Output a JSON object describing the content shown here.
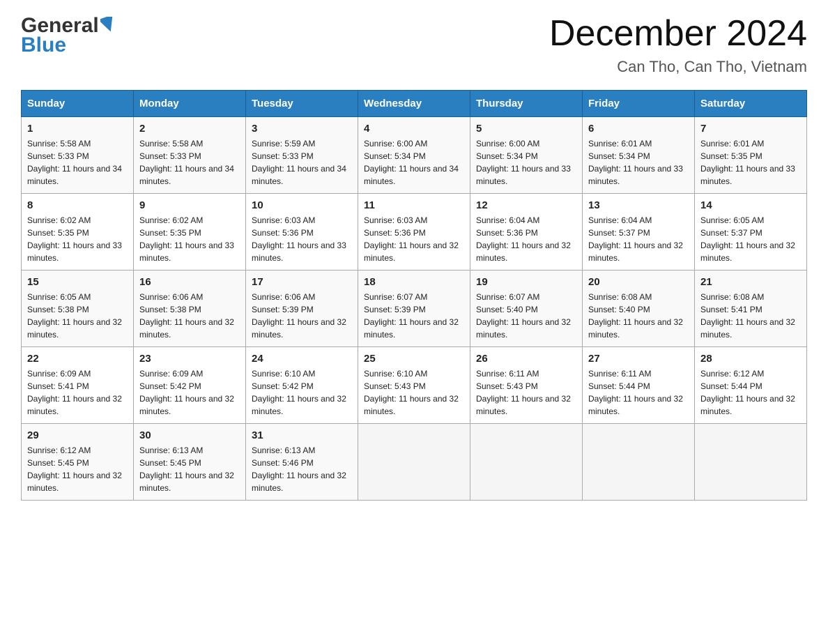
{
  "header": {
    "logo_general": "General",
    "logo_blue": "Blue",
    "month_title": "December 2024",
    "location": "Can Tho, Can Tho, Vietnam"
  },
  "days_of_week": [
    "Sunday",
    "Monday",
    "Tuesday",
    "Wednesday",
    "Thursday",
    "Friday",
    "Saturday"
  ],
  "weeks": [
    [
      {
        "day": "1",
        "sunrise": "5:58 AM",
        "sunset": "5:33 PM",
        "daylight": "11 hours and 34 minutes."
      },
      {
        "day": "2",
        "sunrise": "5:58 AM",
        "sunset": "5:33 PM",
        "daylight": "11 hours and 34 minutes."
      },
      {
        "day": "3",
        "sunrise": "5:59 AM",
        "sunset": "5:33 PM",
        "daylight": "11 hours and 34 minutes."
      },
      {
        "day": "4",
        "sunrise": "6:00 AM",
        "sunset": "5:34 PM",
        "daylight": "11 hours and 34 minutes."
      },
      {
        "day": "5",
        "sunrise": "6:00 AM",
        "sunset": "5:34 PM",
        "daylight": "11 hours and 33 minutes."
      },
      {
        "day": "6",
        "sunrise": "6:01 AM",
        "sunset": "5:34 PM",
        "daylight": "11 hours and 33 minutes."
      },
      {
        "day": "7",
        "sunrise": "6:01 AM",
        "sunset": "5:35 PM",
        "daylight": "11 hours and 33 minutes."
      }
    ],
    [
      {
        "day": "8",
        "sunrise": "6:02 AM",
        "sunset": "5:35 PM",
        "daylight": "11 hours and 33 minutes."
      },
      {
        "day": "9",
        "sunrise": "6:02 AM",
        "sunset": "5:35 PM",
        "daylight": "11 hours and 33 minutes."
      },
      {
        "day": "10",
        "sunrise": "6:03 AM",
        "sunset": "5:36 PM",
        "daylight": "11 hours and 33 minutes."
      },
      {
        "day": "11",
        "sunrise": "6:03 AM",
        "sunset": "5:36 PM",
        "daylight": "11 hours and 32 minutes."
      },
      {
        "day": "12",
        "sunrise": "6:04 AM",
        "sunset": "5:36 PM",
        "daylight": "11 hours and 32 minutes."
      },
      {
        "day": "13",
        "sunrise": "6:04 AM",
        "sunset": "5:37 PM",
        "daylight": "11 hours and 32 minutes."
      },
      {
        "day": "14",
        "sunrise": "6:05 AM",
        "sunset": "5:37 PM",
        "daylight": "11 hours and 32 minutes."
      }
    ],
    [
      {
        "day": "15",
        "sunrise": "6:05 AM",
        "sunset": "5:38 PM",
        "daylight": "11 hours and 32 minutes."
      },
      {
        "day": "16",
        "sunrise": "6:06 AM",
        "sunset": "5:38 PM",
        "daylight": "11 hours and 32 minutes."
      },
      {
        "day": "17",
        "sunrise": "6:06 AM",
        "sunset": "5:39 PM",
        "daylight": "11 hours and 32 minutes."
      },
      {
        "day": "18",
        "sunrise": "6:07 AM",
        "sunset": "5:39 PM",
        "daylight": "11 hours and 32 minutes."
      },
      {
        "day": "19",
        "sunrise": "6:07 AM",
        "sunset": "5:40 PM",
        "daylight": "11 hours and 32 minutes."
      },
      {
        "day": "20",
        "sunrise": "6:08 AM",
        "sunset": "5:40 PM",
        "daylight": "11 hours and 32 minutes."
      },
      {
        "day": "21",
        "sunrise": "6:08 AM",
        "sunset": "5:41 PM",
        "daylight": "11 hours and 32 minutes."
      }
    ],
    [
      {
        "day": "22",
        "sunrise": "6:09 AM",
        "sunset": "5:41 PM",
        "daylight": "11 hours and 32 minutes."
      },
      {
        "day": "23",
        "sunrise": "6:09 AM",
        "sunset": "5:42 PM",
        "daylight": "11 hours and 32 minutes."
      },
      {
        "day": "24",
        "sunrise": "6:10 AM",
        "sunset": "5:42 PM",
        "daylight": "11 hours and 32 minutes."
      },
      {
        "day": "25",
        "sunrise": "6:10 AM",
        "sunset": "5:43 PM",
        "daylight": "11 hours and 32 minutes."
      },
      {
        "day": "26",
        "sunrise": "6:11 AM",
        "sunset": "5:43 PM",
        "daylight": "11 hours and 32 minutes."
      },
      {
        "day": "27",
        "sunrise": "6:11 AM",
        "sunset": "5:44 PM",
        "daylight": "11 hours and 32 minutes."
      },
      {
        "day": "28",
        "sunrise": "6:12 AM",
        "sunset": "5:44 PM",
        "daylight": "11 hours and 32 minutes."
      }
    ],
    [
      {
        "day": "29",
        "sunrise": "6:12 AM",
        "sunset": "5:45 PM",
        "daylight": "11 hours and 32 minutes."
      },
      {
        "day": "30",
        "sunrise": "6:13 AM",
        "sunset": "5:45 PM",
        "daylight": "11 hours and 32 minutes."
      },
      {
        "day": "31",
        "sunrise": "6:13 AM",
        "sunset": "5:46 PM",
        "daylight": "11 hours and 32 minutes."
      },
      null,
      null,
      null,
      null
    ]
  ],
  "labels": {
    "sunrise": "Sunrise:",
    "sunset": "Sunset:",
    "daylight": "Daylight:"
  }
}
